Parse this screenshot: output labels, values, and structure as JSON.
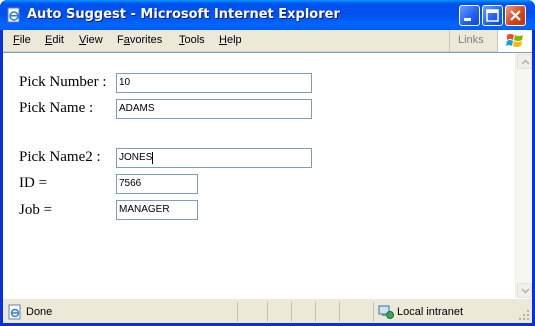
{
  "window": {
    "title": "Auto Suggest - Microsoft Internet Explorer"
  },
  "menu": {
    "items": [
      {
        "accel": "F",
        "rest": "ile"
      },
      {
        "accel": "E",
        "rest": "dit"
      },
      {
        "accel": "V",
        "rest": "iew"
      },
      {
        "pre": "F",
        "accel": "a",
        "rest": "vorites"
      },
      {
        "accel": "T",
        "rest": "ools"
      },
      {
        "accel": "H",
        "rest": "elp"
      }
    ],
    "links_label": "Links"
  },
  "form": {
    "pick_number_label": "Pick Number :",
    "pick_number_value": "10",
    "pick_name_label": "Pick Name :",
    "pick_name_value": "ADAMS",
    "pick_name2_label": "Pick Name2 :",
    "pick_name2_value": "JONES",
    "id_label": "ID =",
    "id_value": "7566",
    "job_label": "Job =",
    "job_value": "MANAGER"
  },
  "status": {
    "text": "Done",
    "zone": "Local intranet"
  },
  "icons": {
    "app": "ie-page-icon",
    "status": "page-done-icon",
    "zone": "local-intranet-icon",
    "logo": "windows-logo-icon"
  },
  "colors": {
    "titlebar": "#0055ea",
    "input_border": "#7f9db9",
    "chrome": "#ece9d8"
  }
}
